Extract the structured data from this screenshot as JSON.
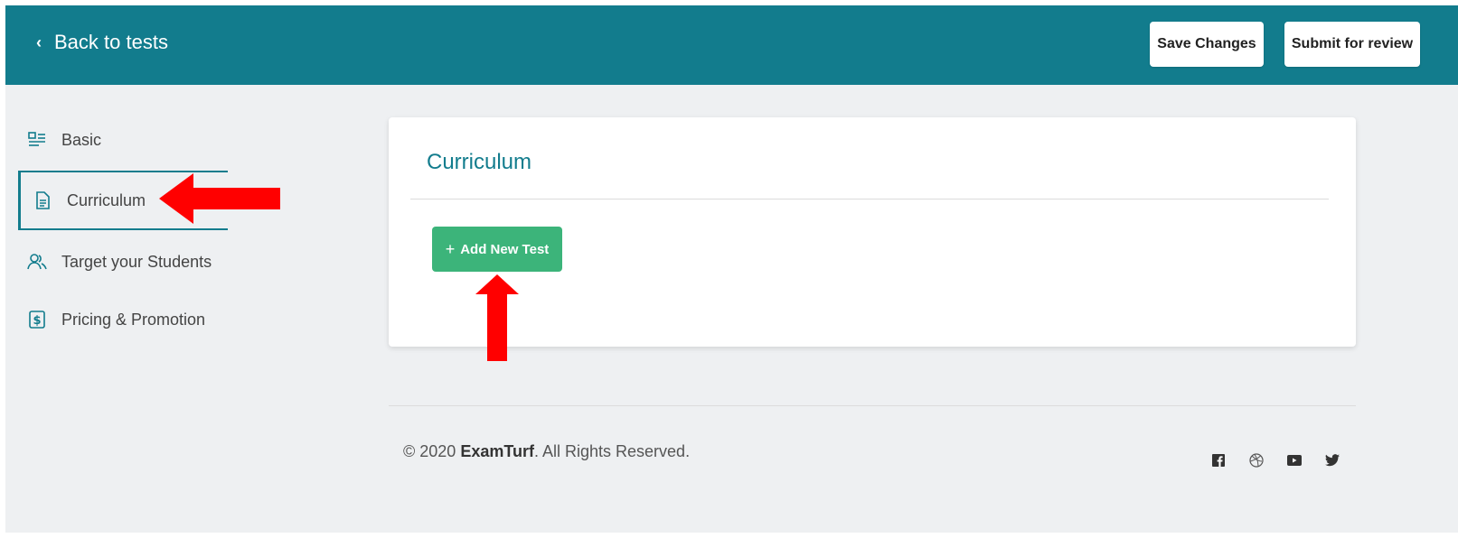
{
  "topbar": {
    "back_label": "Back to tests",
    "save_label": "Save Changes",
    "submit_label": "Submit for review"
  },
  "sidebar": {
    "items": [
      {
        "label": "Basic",
        "icon": "list-icon"
      },
      {
        "label": "Curriculum",
        "icon": "document-icon"
      },
      {
        "label": "Target your Students",
        "icon": "users-icon"
      },
      {
        "label": "Pricing & Promotion",
        "icon": "dollar-icon"
      }
    ],
    "active": "Curriculum"
  },
  "card": {
    "title": "Curriculum",
    "add_button_label": "Add New Test"
  },
  "footer": {
    "copyright_prefix": "© 2020 ",
    "brand": "ExamTurf",
    "copyright_suffix": ". All Rights Reserved.",
    "social_icons": [
      "facebook-icon",
      "dribbble-icon",
      "youtube-icon",
      "twitter-icon"
    ]
  },
  "colors": {
    "primary": "#127c8d",
    "background": "#eef0f2",
    "add_button": "#3cb47a",
    "annotation_arrow": "#ff0000"
  }
}
